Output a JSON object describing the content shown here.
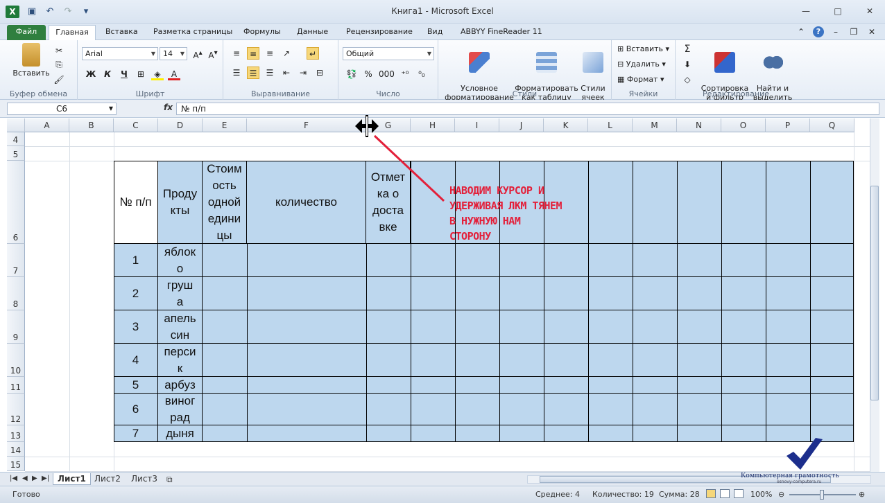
{
  "window": {
    "title": "Книга1  -  Microsoft Excel",
    "minimize": "—",
    "maximize": "□",
    "close": "✕"
  },
  "ribbon_tabs": [
    "Файл",
    "Главная",
    "Вставка",
    "Разметка страницы",
    "Формулы",
    "Данные",
    "Рецензирование",
    "Вид",
    "ABBYY FineReader 11"
  ],
  "ribbon": {
    "clipboard": {
      "label": "Буфер обмена",
      "paste": "Вставить"
    },
    "font": {
      "label": "Шрифт",
      "name": "Arial",
      "size": "14",
      "bold": "Ж",
      "italic": "К",
      "underline": "Ч"
    },
    "alignment": {
      "label": "Выравнивание"
    },
    "number": {
      "label": "Число",
      "format": "Общий",
      "percent": "%",
      "thousands": "000"
    },
    "styles": {
      "label": "Стили",
      "conditional": "Условное\nформатирование",
      "format_table": "Форматировать\nкак таблицу",
      "cell_styles": "Стили\nячеек"
    },
    "cells": {
      "label": "Ячейки",
      "insert": "Вставить",
      "delete": "Удалить",
      "format": "Формат"
    },
    "editing": {
      "label": "Редактирование",
      "sort": "Сортировка\nи фильтр",
      "find": "Найти и\nвыделить",
      "sigma": "Σ"
    }
  },
  "formula_bar": {
    "name_box": "C6",
    "fx": "fx",
    "formula": "№ п/п"
  },
  "columns": [
    "A",
    "B",
    "C",
    "D",
    "E",
    "F",
    "G",
    "H",
    "I",
    "J",
    "K",
    "L",
    "M",
    "N",
    "O",
    "P",
    "Q"
  ],
  "rows": [
    "4",
    "5",
    "6",
    "7",
    "8",
    "9",
    "10",
    "11",
    "12",
    "13",
    "14",
    "15"
  ],
  "table": {
    "headers": [
      "№ п/п",
      "Продукты",
      "Стоимость одной единицы",
      "количество",
      "Отметка о доставке"
    ],
    "header_display": [
      "№ п/п",
      "Проду\nкты",
      "Стоим\nость\nодной\nедини\nцы",
      "количество",
      "Отмет\nка о\nдоста\nвке"
    ],
    "rows": [
      {
        "n": "1",
        "product": "яблок\nо"
      },
      {
        "n": "2",
        "product": "груш\nа"
      },
      {
        "n": "3",
        "product": "апель\nсин"
      },
      {
        "n": "4",
        "product": "перси\nк"
      },
      {
        "n": "5",
        "product": "арбуз"
      },
      {
        "n": "6",
        "product": "виног\nрад"
      },
      {
        "n": "7",
        "product": "дыня"
      }
    ]
  },
  "annotation": "НАВОДИМ КУРСОР И УДЕРЖИВАЯ ЛКМ ТЯНЕМ В НУЖНУЮ НАМ СТОРОНУ",
  "sheets": [
    "Лист1",
    "Лист2",
    "Лист3"
  ],
  "status": {
    "ready": "Готово",
    "average": "Среднее: 4",
    "count": "Количество: 19",
    "sum": "Сумма: 28",
    "zoom": "100%"
  },
  "watermark": {
    "line1": "Компьютерная грамотность",
    "line2": "osnovy-computera.ru"
  },
  "colors": {
    "table_fill": "#bdd7ee",
    "file_tab": "#2f7f3f",
    "annotation": "#e3203a"
  }
}
